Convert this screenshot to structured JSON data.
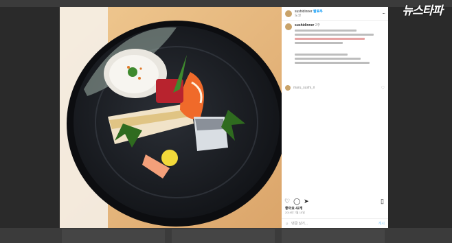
{
  "watermark": "뉴스타파",
  "post": {
    "username": "sushidinner",
    "follow_label": "팔로우",
    "location": "도쿄",
    "more_label": "...",
    "caption_username": "sushidinner",
    "caption_time": "2주",
    "comment_username": "maru_sushi_ri",
    "likes_text": "좋아요 42개",
    "date_text": "2019년 7월 15일",
    "add_comment_placeholder": "댓글 달기...",
    "post_button": "게시"
  },
  "icons": {
    "like": "heart-icon",
    "comment": "comment-icon",
    "share": "share-icon",
    "save": "bookmark-icon",
    "emoji": "emoji-icon",
    "more": "more-icon"
  },
  "colors": {
    "accent": "#0095f6",
    "background": "#2a2a2a"
  }
}
